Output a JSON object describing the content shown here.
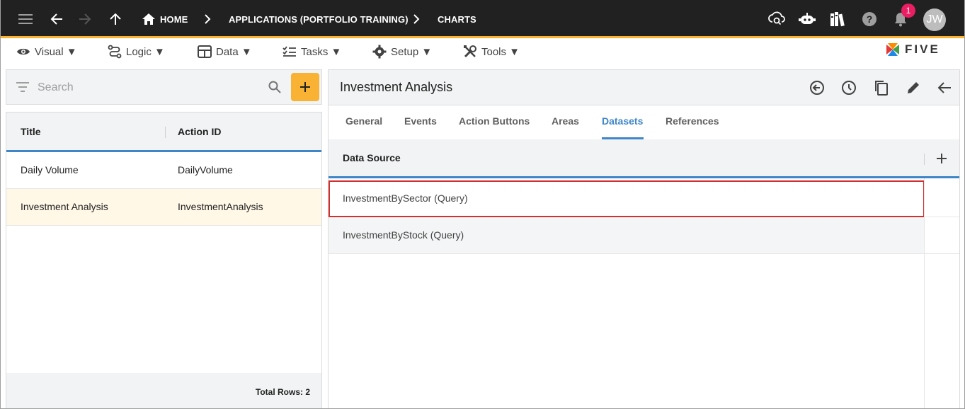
{
  "topbar": {
    "breadcrumbs": [
      {
        "label": "HOME"
      },
      {
        "label": "APPLICATIONS (PORTFOLIO TRAINING)"
      },
      {
        "label": "CHARTS"
      }
    ],
    "notification_count": "1",
    "avatar_initials": "JW",
    "icons": [
      "menu-icon",
      "back-arrow-icon",
      "forward-arrow-icon",
      "up-arrow-icon",
      "home-icon",
      "cloud-search-icon",
      "chatbot-icon",
      "library-icon",
      "help-icon",
      "bell-icon"
    ]
  },
  "menubar": {
    "items": [
      {
        "label": "Visual ▼",
        "icon": "eye-icon"
      },
      {
        "label": "Logic ▼",
        "icon": "logic-icon"
      },
      {
        "label": "Data ▼",
        "icon": "table-icon"
      },
      {
        "label": "Tasks ▼",
        "icon": "tasks-icon"
      },
      {
        "label": "Setup ▼",
        "icon": "gear-icon"
      },
      {
        "label": "Tools ▼",
        "icon": "tools-icon"
      }
    ],
    "logo_text": "FIVE"
  },
  "left_panel": {
    "search_placeholder": "Search",
    "columns": [
      "Title",
      "Action ID"
    ],
    "rows": [
      {
        "title": "Daily Volume",
        "action_id": "DailyVolume"
      },
      {
        "title": "Investment Analysis",
        "action_id": "InvestmentAnalysis"
      }
    ],
    "selected_row": 1,
    "total_rows_label": "Total Rows: 2"
  },
  "right_panel": {
    "title": "Investment Analysis",
    "tabs": [
      "General",
      "Events",
      "Action Buttons",
      "Areas",
      "Datasets",
      "References"
    ],
    "active_tab": "Datasets",
    "datasets": {
      "column": "Data Source",
      "rows": [
        "InvestmentBySector (Query)",
        "InvestmentByStock (Query)"
      ],
      "highlighted_row": 0
    }
  },
  "colors": {
    "accent": "#f9b233",
    "topbar_bg": "#212121",
    "active_blue": "#3f86c8",
    "highlight_red": "#d32f2f",
    "badge": "#e91e63"
  }
}
